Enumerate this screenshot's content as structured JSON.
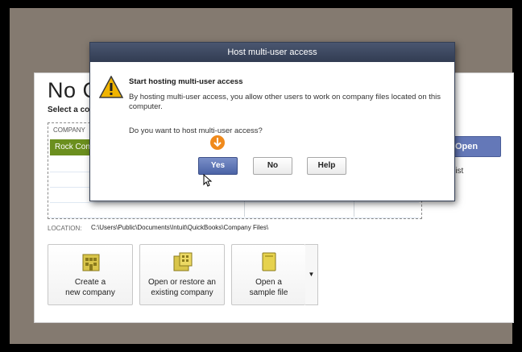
{
  "background": {
    "title": "No C",
    "select_label": "Select a co",
    "list_header": "COMPANY",
    "selected_row": "Rock Con",
    "open_button": "Open",
    "edit_list_link": "lt List",
    "location_label": "LOCATION:",
    "location_path": "C:\\Users\\Public\\Documents\\Intuit\\QuickBooks\\Company Files\\",
    "actions": [
      {
        "line1": "Create a",
        "line2": "new company"
      },
      {
        "line1": "Open or restore an",
        "line2": "existing company"
      },
      {
        "line1": "Open a",
        "line2": "sample file"
      }
    ]
  },
  "dialog": {
    "title": "Host multi-user access",
    "heading": "Start hosting multi-user access",
    "message": "By hosting multi-user access, you allow other users to work on company files located on this computer.",
    "question": "Do you want to host multi-user access?",
    "yes_label": "Yes",
    "no_label": "No",
    "help_label": "Help"
  },
  "colors": {
    "selected_row": "#6b8f1e",
    "open_button": "#6478b8",
    "dialog_titlebar": "#3b465e",
    "yes_button": "#5a71b4",
    "pointer_badge": "#f08a1c",
    "warning": "#f0b400"
  }
}
